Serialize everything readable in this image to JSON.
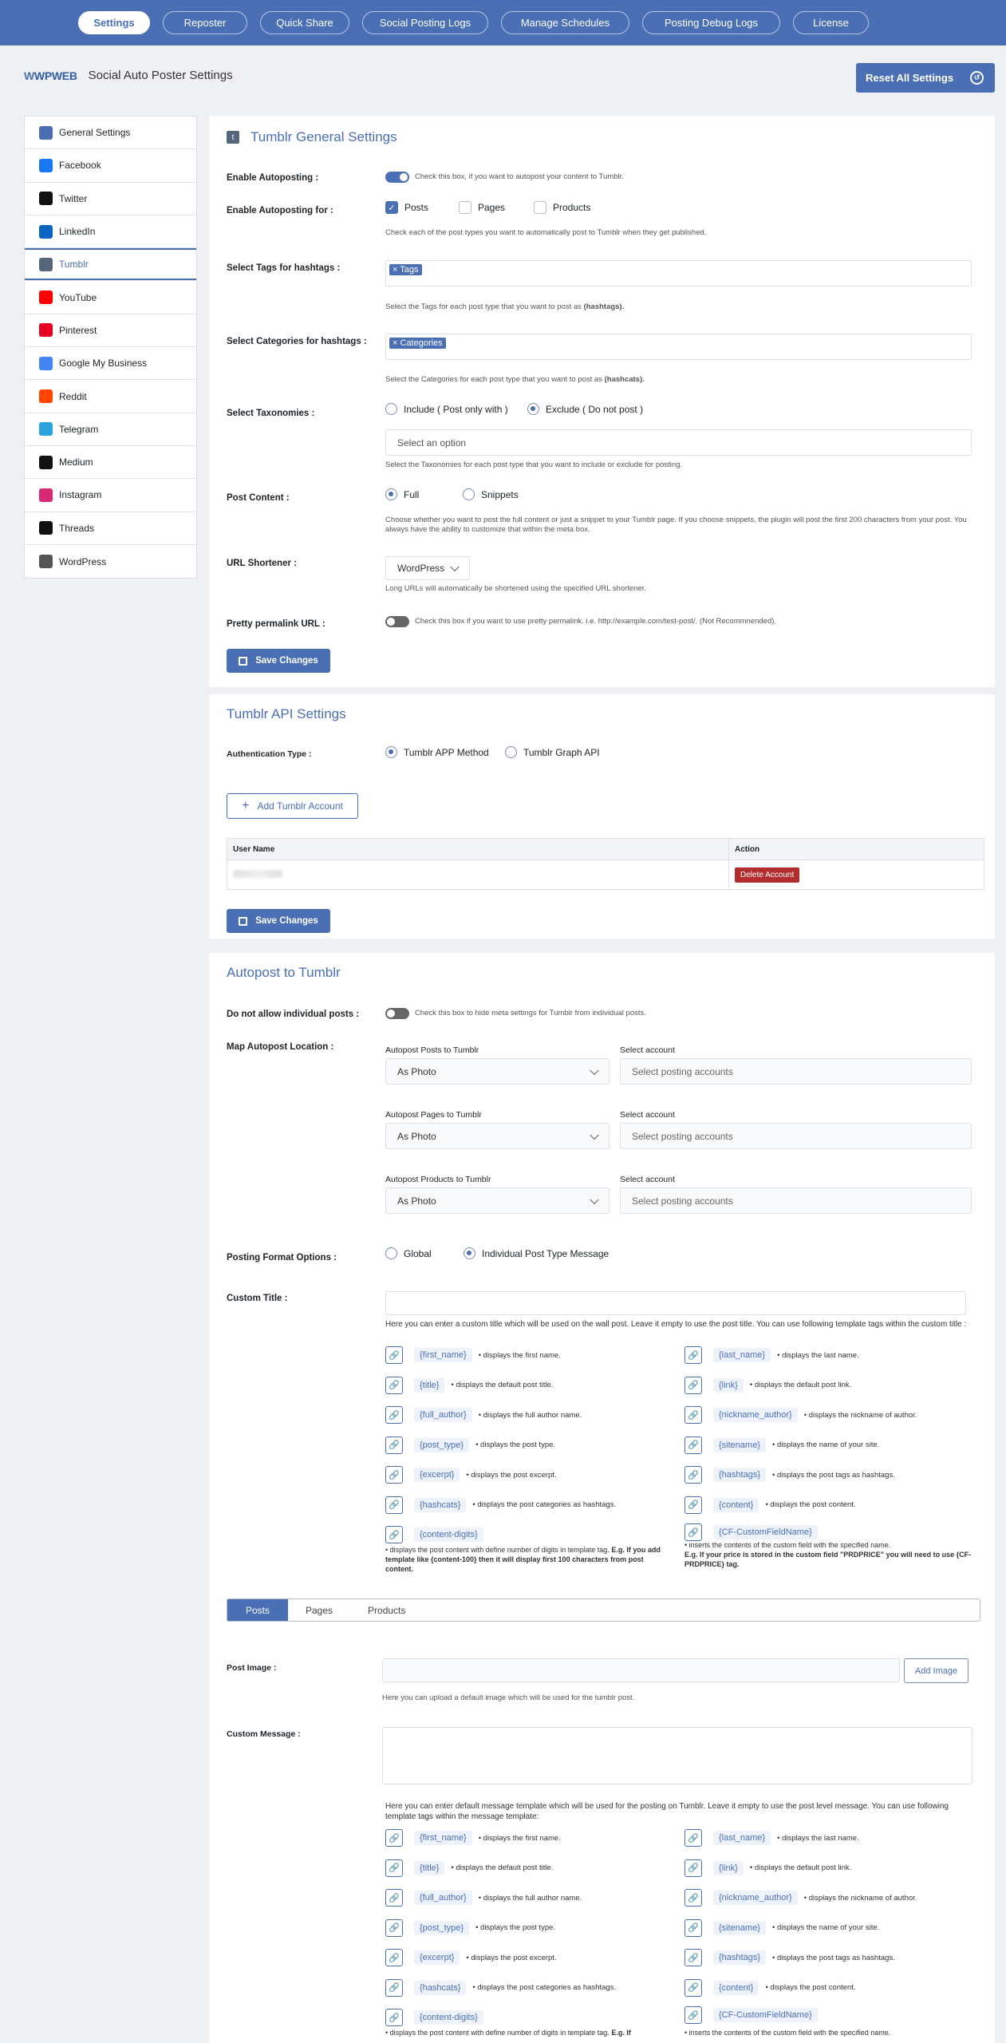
{
  "nav": {
    "tabs": [
      {
        "label": "Settings",
        "active": true
      },
      {
        "label": "Reposter"
      },
      {
        "label": "Quick Share"
      },
      {
        "label": "Social Posting Logs"
      },
      {
        "label": "Manage Schedules"
      },
      {
        "label": "Posting Debug Logs"
      },
      {
        "label": "License"
      }
    ]
  },
  "brand": {
    "logo_w": "W",
    "logo_text": "WPWEB",
    "title": "Social Auto Poster Settings"
  },
  "reset_label": "Reset All Settings",
  "sidebar": {
    "items": [
      {
        "label": "General Settings",
        "icon": "wpweb-icon",
        "color": "#4a6fb5"
      },
      {
        "label": "Facebook",
        "icon": "facebook-icon",
        "color": "#1877f2"
      },
      {
        "label": "Twitter",
        "icon": "x-twitter-icon",
        "color": "#111111"
      },
      {
        "label": "LinkedIn",
        "icon": "linkedin-icon",
        "color": "#0a66c2"
      },
      {
        "label": "Tumblr",
        "icon": "tumblr-icon",
        "color": "#56677c",
        "active": true
      },
      {
        "label": "YouTube",
        "icon": "youtube-icon",
        "color": "#ff0000"
      },
      {
        "label": "Pinterest",
        "icon": "pinterest-icon",
        "color": "#e60023"
      },
      {
        "label": "Google My Business",
        "icon": "google-business-icon",
        "color": "#4285f4"
      },
      {
        "label": "Reddit",
        "icon": "reddit-icon",
        "color": "#ff4500"
      },
      {
        "label": "Telegram",
        "icon": "telegram-icon",
        "color": "#2aa3df"
      },
      {
        "label": "Medium",
        "icon": "medium-icon",
        "color": "#111111"
      },
      {
        "label": "Instagram",
        "icon": "instagram-icon",
        "color": "#d62976"
      },
      {
        "label": "Threads",
        "icon": "threads-icon",
        "color": "#111111"
      },
      {
        "label": "WordPress",
        "icon": "wordpress-icon",
        "color": "#555555"
      }
    ]
  },
  "general": {
    "title": "Tumblr General Settings",
    "tumblr_glyph": "t",
    "autopost_label": "Enable Autoposting :",
    "autopost_help": "Check this box, if you want to autopost your content to Tumblr.",
    "autopost_for_label": "Enable Autoposting for :",
    "post_types": [
      {
        "label": "Posts",
        "checked": true
      },
      {
        "label": "Pages",
        "checked": false
      },
      {
        "label": "Products",
        "checked": false
      }
    ],
    "autopost_for_help": "Check each of the post types you want to automatically post to Tumblr when they get published.",
    "tags_label": "Select Tags for hashtags :",
    "tags_chip": "× Tags",
    "tags_help_a": "Select the Tags for each post type that you want to post as ",
    "tags_help_b": "(hashtags).",
    "cats_label": "Select Categories for hashtags :",
    "cats_chip": "× Categories",
    "cats_help_a": "Select the Categories for each post type that you want to post as ",
    "cats_help_b": "(hashcats).",
    "tax_label": "Select Taxonomies :",
    "tax_opts": [
      {
        "label": "Include ( Post only with )",
        "checked": false
      },
      {
        "label": "Exclude ( Do not post )",
        "checked": true
      }
    ],
    "tax_placeholder": "Select an option",
    "tax_help": "Select the Taxonomies for each post type that you want to include or exclude for posting.",
    "content_label": "Post Content :",
    "content_opts": [
      {
        "label": "Full",
        "checked": true
      },
      {
        "label": "Snippets",
        "checked": false
      }
    ],
    "content_help": "Choose whether you want to post the full content or just a snippet to your Tumblr page. If you choose snippets, the plugin will post the first 200 characters from your post. You always have the ability to customize that within the meta box.",
    "shortener_label": "URL Shortener :",
    "shortener_value": "WordPress",
    "shortener_help": "Long URLs will automatically be shortened using the specified URL shortener.",
    "permalink_label": "Pretty permalink URL :",
    "permalink_help": "Check this box if you want to use pretty permalink. i.e. http://example.com/test-post/. (Not Recommnended).",
    "save_label": "Save Changes"
  },
  "api": {
    "title": "Tumblr API Settings",
    "auth_label": "Authentication Type :",
    "auth_opts": [
      {
        "label": "Tumblr APP Method",
        "checked": true
      },
      {
        "label": "Tumblr Graph API",
        "checked": false
      }
    ],
    "add_label": "Add Tumblr Account",
    "col_user": "User Name",
    "col_action": "Action",
    "delete_label": "Delete Account",
    "save_label": "Save Changes"
  },
  "autopost": {
    "title": "Autopost to Tumblr",
    "individual_label": "Do not allow individual posts :",
    "individual_help": "Check this box to hide meta settings for Tumblr from individual posts.",
    "map_label": "Map Autopost Location :",
    "maps": [
      {
        "label": "Autopost Posts to Tumblr",
        "value": "As Photo",
        "acct_label": "Select account",
        "acct_placeholder": "Select posting accounts"
      },
      {
        "label": "Autopost Pages to Tumblr",
        "value": "As Photo",
        "acct_label": "Select account",
        "acct_placeholder": "Select posting accounts"
      },
      {
        "label": "Autopost Products to Tumblr",
        "value": "As Photo",
        "acct_label": "Select account",
        "acct_placeholder": "Select posting accounts"
      }
    ],
    "format_label": "Posting Format Options :",
    "format_opts": [
      {
        "label": "Global",
        "checked": false
      },
      {
        "label": "Individual Post Type Message",
        "checked": true
      }
    ],
    "custom_title_label": "Custom Title :",
    "custom_title_help": "Here you can enter a custom title which will be used on the wall post. Leave it empty to use the post title. You can use following template tags within the custom title :",
    "tags": [
      {
        "tag": "{first_name}",
        "desc": "displays the first name."
      },
      {
        "tag": "{last_name}",
        "desc": "displays the last name."
      },
      {
        "tag": "{title}",
        "desc": "displays the default post title."
      },
      {
        "tag": "{link}",
        "desc": "displays the default post link."
      },
      {
        "tag": "{full_author}",
        "desc": "displays the full author name."
      },
      {
        "tag": "{nickname_author}",
        "desc": "displays the nickname of author."
      },
      {
        "tag": "{post_type}",
        "desc": "displays the post type."
      },
      {
        "tag": "{sitename}",
        "desc": "displays the name of your site."
      },
      {
        "tag": "{excerpt}",
        "desc": "displays the post excerpt."
      },
      {
        "tag": "{hashtags}",
        "desc": "displays the post tags as hashtags."
      },
      {
        "tag": "{hashcats}",
        "desc": "displays the post categories as hashtags."
      },
      {
        "tag": "{content}",
        "desc": "displays the post content."
      }
    ],
    "digits_tag": "{content-digits}",
    "digits_desc": "• displays the post content with define number of digits in template tag. ",
    "digits_bold": "E.g. If you add template like {content-100} then it will display first 100 characters from post content.",
    "digits_desc_trunc": "• displays the post content with define number of digits in template tag. ",
    "digits_bold_trunc": "E.g. If",
    "cf_tag": "{CF-CustomFieldName}",
    "cf_desc": "• inserts the contents of the custom field with the specified name.",
    "cf_bold": "E.g. If your price is stored in the custom field \"PRDPRICE\" you will need to use {CF-PRDPRICE} tag.",
    "subtabs": [
      {
        "label": "Posts",
        "active": true
      },
      {
        "label": "Pages"
      },
      {
        "label": "Products"
      }
    ],
    "image_label": "Post Image :",
    "add_image_label": "Add Image",
    "image_help": "Here you can upload a default image which will be used for the tumblr post.",
    "message_label": "Custom Message :",
    "message_help": "Here you can enter default message template which will be used for the posting on Tumblr. Leave it empty to use the post level message. You can use following template tags within the message template:"
  }
}
